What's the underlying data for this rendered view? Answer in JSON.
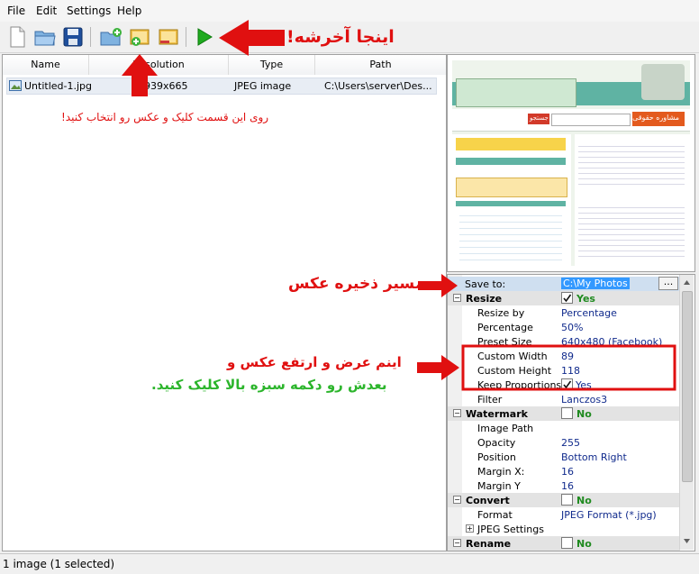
{
  "menu": {
    "file": "File",
    "edit": "Edit",
    "settings": "Settings",
    "help": "Help"
  },
  "columns": {
    "name": "Name",
    "resolution": "Resolution",
    "type": "Type",
    "path": "Path"
  },
  "file": {
    "name": "Untitled-1.jpg",
    "resolution": "939x665",
    "type": "JPEG image",
    "path": "C:\\Users\\server\\Des..."
  },
  "props": {
    "save_to_label": "Save to:",
    "save_to_value": "C:\\My Photos",
    "browse": "...",
    "resize": "Resize",
    "resize_value": "Yes",
    "resize_by_label": "Resize by",
    "resize_by_value": "Percentage",
    "percentage_label": "Percentage",
    "percentage_value": "50%",
    "preset_label": "Preset Size",
    "preset_value": "640x480 (Facebook)",
    "custom_width_label": "Custom Width",
    "custom_width_value": "89",
    "custom_height_label": "Custom Height",
    "custom_height_value": "118",
    "keep_label": "Keep Proportions",
    "keep_value": "Yes",
    "filter_label": "Filter",
    "filter_value": "Lanczos3",
    "watermark": "Watermark",
    "watermark_value": "No",
    "image_path_label": "Image Path",
    "opacity_label": "Opacity",
    "opacity_value": "255",
    "position_label": "Position",
    "position_value": "Bottom Right",
    "margin_x_label": "Margin X:",
    "margin_x_value": "16",
    "margin_y_label": "Margin Y",
    "margin_y_value": "16",
    "convert": "Convert",
    "convert_value": "No",
    "format_label": "Format",
    "format_value": "JPEG Format (*.jpg)",
    "jpeg_settings": "JPEG Settings",
    "rename": "Rename",
    "rename_value": "No"
  },
  "status": "1 image (1 selected)",
  "annotations": {
    "finish": "اینجا آخرشه!",
    "select_here": "روی این قسمت کلیک و عکس رو انتخاب کنید!",
    "save_path": "مسیر ذخیره عکس",
    "size_line1": "اینم عرض و ارتفع عکس و",
    "size_line2": "بعدش رو دکمه سبزه بالا کلیک کنید."
  },
  "preview": {
    "logo": "مشاوره حقوقی",
    "search": "جستجو"
  },
  "colors": {
    "annotation_red": "#e01010",
    "annotation_green": "#2cb52c",
    "value_blue": "#102a8c"
  }
}
